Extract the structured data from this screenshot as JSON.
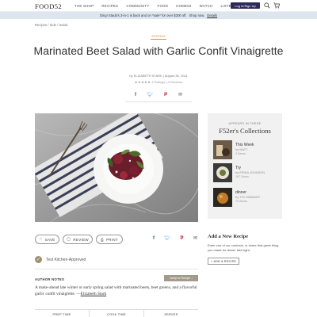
{
  "header": {
    "logo": "FOOD52",
    "nav": [
      "THE SHOP",
      "RECIPES",
      "COMMUNITY",
      "FOOD",
      "HOME52",
      "WATCH",
      "LISTEN"
    ],
    "login_label": "Log In/Sign Up"
  },
  "promo": {
    "text": "Ding! Staub's 3-in-1 is back and on *sale* for over $200 off.",
    "time": "Shop now.",
    "link": "Details"
  },
  "breadcrumb": "Recipes / Side / Salad",
  "recipe": {
    "tag": "SPRING",
    "title": "Marinated Beet Salad with Garlic Confit Vinaigrette",
    "author_prefix": "by",
    "author": "ELIZABETH STARK",
    "date": "August 30, 2011",
    "stars": "★★★★★",
    "ratings": "2 Ratings",
    "reviews": "0 Reviews"
  },
  "share_icons": [
    "facebook-icon",
    "twitter-icon",
    "pinterest-icon",
    "email-icon"
  ],
  "collections": {
    "heading": "APPEARS IN THESE",
    "title": "F52er's Collections",
    "items": [
      {
        "name": "This Week",
        "by": "by MATT",
        "count": "3 Saves"
      },
      {
        "name": "Try",
        "by": "by ERIKA JOHNSON",
        "count": "167 Saves"
      },
      {
        "name": "dinner",
        "by": "by TIO HIMMANT",
        "count": "79 Saves"
      }
    ]
  },
  "add_recipe": {
    "title": "Add a New Recipe",
    "desc": "Enter one of our contests, or share that great thing you made for dinner last night.",
    "button": "+ ADD A RECIPE"
  },
  "actions": {
    "save": "SAVE",
    "review": "REVIEW",
    "print": "PRINT"
  },
  "approved": "Test Kitchen-Approved",
  "notes": {
    "heading": "AUTHOR NOTES",
    "jump": "Jump to Recipe ↓",
    "body": "A make-ahead late winter or early spring salad with marinated beets, beet greens, and a flavorful garlic confit vinaigrette. —",
    "author": "Elizabeth Stark"
  },
  "stats": [
    "PREP TIME",
    "COOK TIME",
    "SERVES"
  ],
  "colors": {
    "accent": "#d08a3a",
    "login_bg": "#2d2a5a",
    "promo_bg": "#dde6ee",
    "facebook": "#3b5998",
    "twitter": "#1da1f2",
    "pinterest": "#bd081c"
  }
}
